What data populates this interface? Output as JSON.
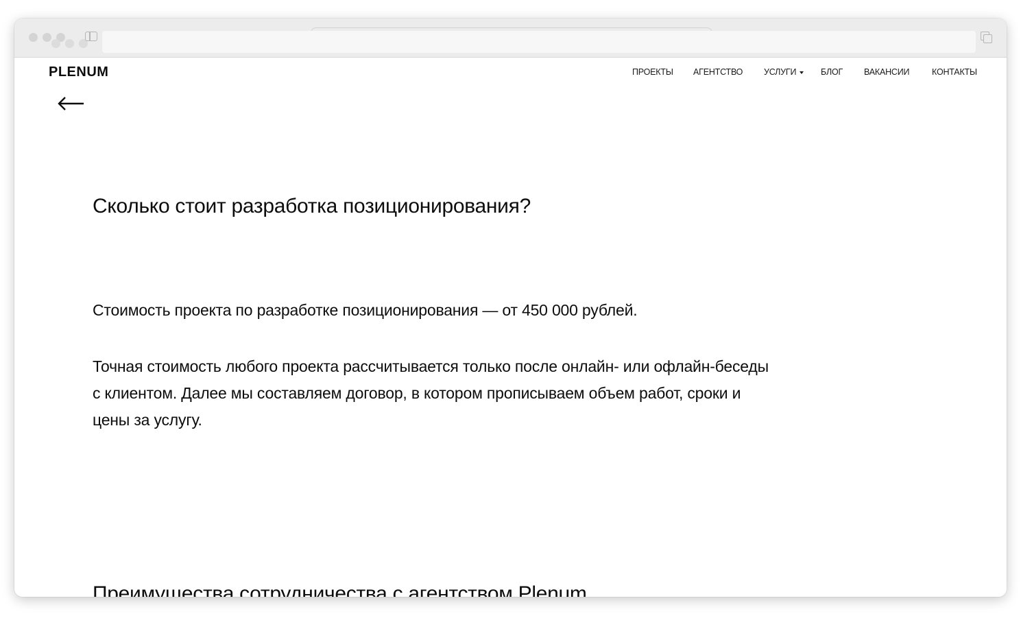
{
  "site": {
    "logo": "PLENUM"
  },
  "nav": {
    "items": [
      {
        "label": "ПРОЕКТЫ"
      },
      {
        "label": "АГЕНТСТВО"
      },
      {
        "label": "УСЛУГИ"
      },
      {
        "label": "БЛОГ"
      },
      {
        "label": "ВАКАНСИИ"
      },
      {
        "label": "КОНТАКТЫ"
      }
    ]
  },
  "icons": {
    "back": "arrow-left-icon",
    "dropdown": "caret-down-icon",
    "sidebar": "sidebar-icon",
    "tabs": "tabs-overview-icon"
  },
  "content": {
    "heading": "Сколько стоит разработка позиционирования?",
    "paragraph1": "Стоимость проекта по разработке позиционирования — от 450 000 рублей.",
    "paragraph2": "Точная стоимость любого проекта рассчитывается только после онлайн- или офлайн-беседы с клиентом. Далее мы составляем договор, в котором прописываем объем работ, сроки и цены за услугу.",
    "next_heading": "Преимущества сотрудничества с агентством Plenum"
  },
  "colors": {
    "text": "#0d0d0d",
    "chrome": "#ececec",
    "background": "#ffffff"
  }
}
